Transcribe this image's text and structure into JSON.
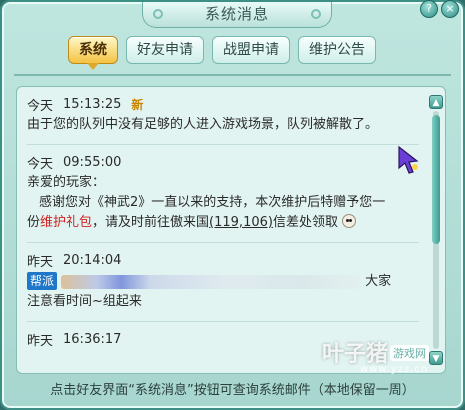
{
  "window": {
    "title": "系统消息"
  },
  "tabs": [
    {
      "label": "系统",
      "active": true
    },
    {
      "label": "好友申请",
      "active": false
    },
    {
      "label": "战盟申请",
      "active": false
    },
    {
      "label": "维护公告",
      "active": false
    }
  ],
  "messages": [
    {
      "day": "今天",
      "time": "15:13:25",
      "badge": "新",
      "text": "由于您的队列中没有足够的人进入游戏场景，队列被解散了。"
    },
    {
      "day": "今天",
      "time": "09:55:00",
      "greeting": "亲爱的玩家：",
      "line1": "感谢您对《神武2》一直以来的支持，本次维护后特赠予您一",
      "line2_prefix": "份",
      "gift": "维护礼包",
      "line2_suffix": "，请及时前往傲来国",
      "coords": "(119,106)",
      "line2_end": "信差处领取"
    },
    {
      "day": "昨天",
      "time": "20:14:04",
      "tag": "帮派",
      "tail": "大家",
      "line2": "注意看时间~组起来"
    },
    {
      "day": "昨天",
      "time": "16:36:17"
    }
  ],
  "footer": {
    "text": "点击好友界面“系统消息”按钮可查询系统邮件（本地保留一周）"
  },
  "watermark": {
    "main": "叶子猪",
    "badge": "游戏网",
    "url": "www.yzz.cn"
  },
  "icons": {
    "cursor": "wand-cursor-icon",
    "emoji": "smiley-icon",
    "scroll_up": "arrow-up-icon",
    "scroll_down": "arrow-down-icon"
  },
  "colors": {
    "active_tab": "#f3c343",
    "gift_highlight": "#d21e1e",
    "guild_tag": "#1f77c9"
  }
}
